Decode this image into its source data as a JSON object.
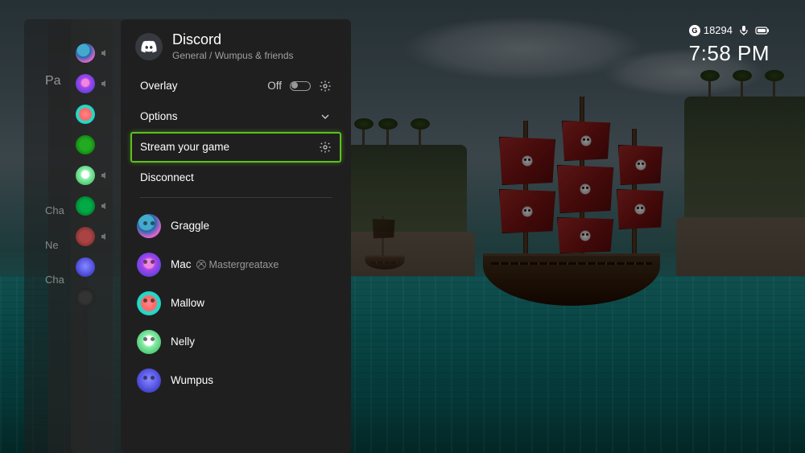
{
  "status": {
    "credits_badge": "G",
    "credits": "18294",
    "time": "7:58 PM"
  },
  "ghost": {
    "label_partial": "Pa",
    "items": [
      "Cha",
      "Ne",
      "Cha"
    ]
  },
  "panel": {
    "app_name": "Discord",
    "subtitle": "General / Wumpus & friends",
    "menu": {
      "overlay": {
        "label": "Overlay",
        "state": "Off"
      },
      "options": {
        "label": "Options"
      },
      "stream": {
        "label": "Stream your game"
      },
      "disconnect": {
        "label": "Disconnect"
      }
    },
    "participants": [
      {
        "name": "Graggle",
        "avatar": "av-graggle"
      },
      {
        "name": "Mac",
        "avatar": "av-mac",
        "gamertag": "Mastergreataxe"
      },
      {
        "name": "Mallow",
        "avatar": "av-mallow"
      },
      {
        "name": "Nelly",
        "avatar": "av-nelly"
      },
      {
        "name": "Wumpus",
        "avatar": "av-wumpus"
      }
    ]
  }
}
